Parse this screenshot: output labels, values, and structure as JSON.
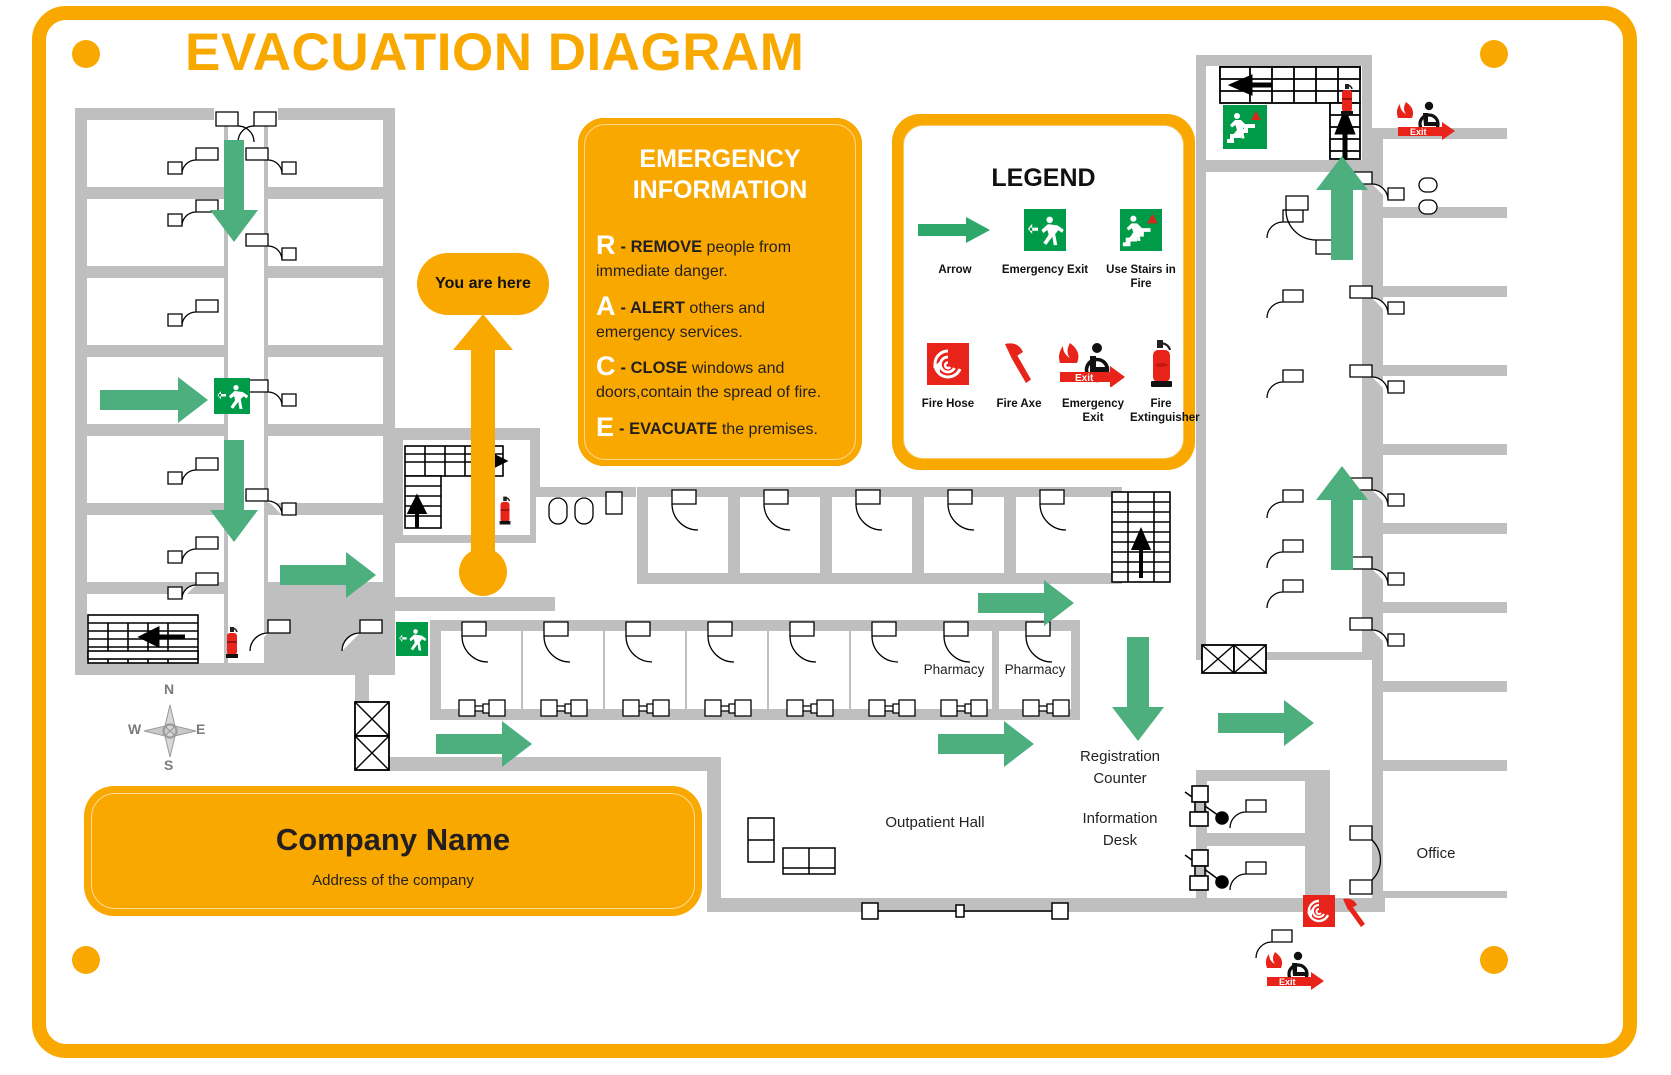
{
  "page": {
    "title": "EVACUATION DIAGRAM",
    "accent_orange": "#F9A800",
    "accent_green": "#4CAF7D",
    "wall_gray": "#BFBFBF",
    "exit_green": "#009B48",
    "fire_red": "#E8231A"
  },
  "emergency": {
    "title_line1": "EMERGENCY",
    "title_line2": "INFORMATION",
    "items": [
      {
        "letter": "R",
        "keyword": "- REMOVE",
        "text": " people from immediate danger."
      },
      {
        "letter": "A",
        "keyword": "- ALERT",
        "text": " others and emergency services."
      },
      {
        "letter": "C",
        "keyword": "- CLOSE",
        "text": " windows and doors,contain the spread of fire."
      },
      {
        "letter": "E",
        "keyword": "- EVACUATE",
        "text": " the premises."
      }
    ]
  },
  "legend": {
    "title": "LEGEND",
    "items": [
      {
        "icon": "green-arrow-icon",
        "label": "Arrow"
      },
      {
        "icon": "emergency-exit-icon",
        "label": "Emergency Exit"
      },
      {
        "icon": "use-stairs-in-fire-icon",
        "label": "Use Stairs in Fire"
      },
      {
        "icon": "fire-hose-icon",
        "label": "Fire Hose"
      },
      {
        "icon": "fire-axe-icon",
        "label": "Fire Axe"
      },
      {
        "icon": "accessible-emergency-exit-icon",
        "label": "Emergency Exit"
      },
      {
        "icon": "fire-extinguisher-icon",
        "label": "Fire Extinguisher"
      }
    ]
  },
  "marker": {
    "you_are_here": "You are here"
  },
  "company": {
    "name": "Company Name",
    "address": "Address of the company"
  },
  "compass": {
    "north": "N",
    "south": "S",
    "east": "E",
    "west": "W"
  },
  "plan_labels": {
    "pharmacy_1": "Pharmacy",
    "pharmacy_2": "Pharmacy",
    "registration_counter": "Registration\nCounter",
    "registration_counter_l1": "Registration",
    "registration_counter_l2": "Counter",
    "information_desk_l1": "Information",
    "information_desk_l2": "Desk",
    "outpatient_hall": "Outpatient Hall",
    "office": "Office"
  }
}
